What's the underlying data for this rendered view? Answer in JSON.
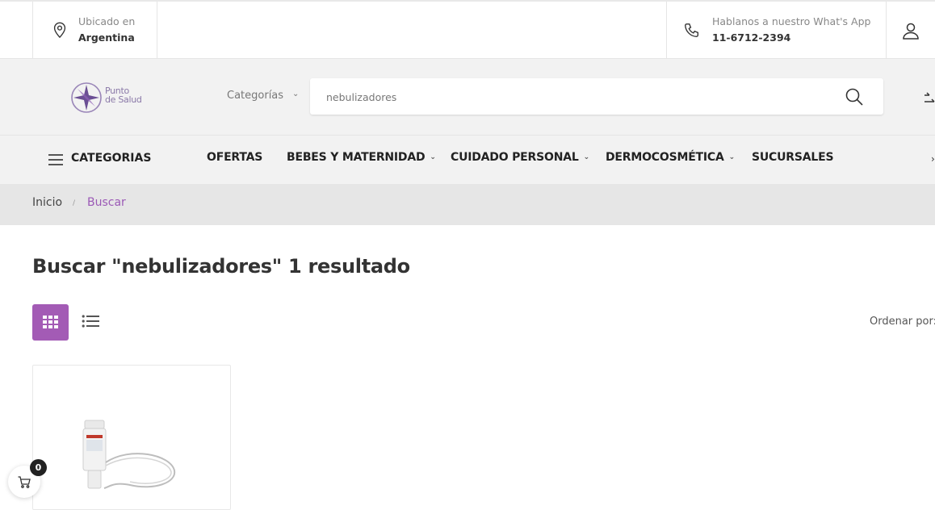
{
  "topbar": {
    "location_label": "Ubicado en",
    "location_value": "Argentina",
    "contact_label": "Hablanos a nuestro What's App",
    "contact_value": "11-6712-2394"
  },
  "header": {
    "logo_line1": "Punto",
    "logo_line2": "de Salud",
    "category_select": "Categorías",
    "search_value": "nebulizadores"
  },
  "nav": {
    "categories_label": "CATEGORIAS",
    "items": [
      {
        "label": "OFERTAS",
        "has_dropdown": false
      },
      {
        "label": "BEBES Y MATERNIDAD",
        "has_dropdown": true
      },
      {
        "label": "CUIDADO PERSONAL",
        "has_dropdown": true
      },
      {
        "label": "DERMOCOSMÉTICA",
        "has_dropdown": true
      },
      {
        "label": "SUCURSALES",
        "has_dropdown": false
      }
    ]
  },
  "breadcrumb": {
    "home": "Inicio",
    "separator": "/",
    "current": "Buscar"
  },
  "results": {
    "title": "Buscar  \"nebulizadores\" 1 resultado",
    "sort_label": "Ordenar por:"
  },
  "cart": {
    "count": "0"
  },
  "colors": {
    "accent": "#a35bb5",
    "breadcrumb_active": "#9b59b6"
  }
}
